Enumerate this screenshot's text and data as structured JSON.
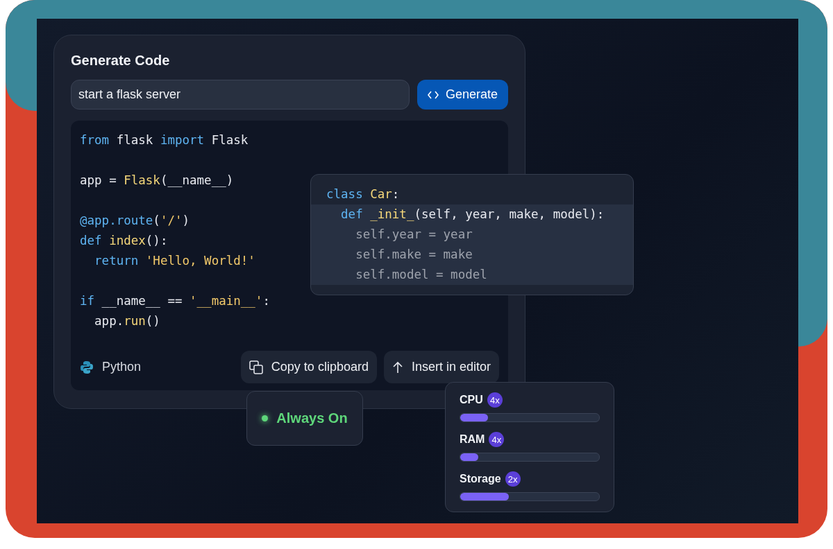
{
  "generator": {
    "title": "Generate Code",
    "prompt": {
      "value": "start a flask server"
    },
    "generate_button": {
      "label": "Generate"
    },
    "code_lines": [
      {
        "kind": "code",
        "tokens": [
          {
            "text": "from",
            "kind": "keyword"
          },
          {
            "text": " flask ",
            "kind": "plain"
          },
          {
            "text": "import",
            "kind": "keyword"
          },
          {
            "text": " Flask",
            "kind": "plain"
          }
        ]
      },
      {
        "kind": "blank"
      },
      {
        "kind": "code",
        "tokens": [
          {
            "text": "app = ",
            "kind": "plain"
          },
          {
            "text": "Flask",
            "kind": "name"
          },
          {
            "text": "(__name__)",
            "kind": "plain"
          }
        ]
      },
      {
        "kind": "blank"
      },
      {
        "kind": "code",
        "tokens": [
          {
            "text": "@app.route",
            "kind": "keyword"
          },
          {
            "text": "(",
            "kind": "plain"
          },
          {
            "text": "'/'",
            "kind": "string"
          },
          {
            "text": ")",
            "kind": "plain"
          }
        ]
      },
      {
        "kind": "code",
        "tokens": [
          {
            "text": "def",
            "kind": "keyword"
          },
          {
            "text": " index",
            "kind": "name"
          },
          {
            "text": "():",
            "kind": "plain"
          }
        ]
      },
      {
        "kind": "code",
        "tokens": [
          {
            "text": "  return ",
            "kind": "keyword"
          },
          {
            "text": "'Hello, World!'",
            "kind": "string"
          }
        ]
      },
      {
        "kind": "blank"
      },
      {
        "kind": "code",
        "tokens": [
          {
            "text": "if",
            "kind": "keyword"
          },
          {
            "text": " __name__ == ",
            "kind": "plain"
          },
          {
            "text": "'__main__'",
            "kind": "string"
          },
          {
            "text": ":",
            "kind": "plain"
          }
        ]
      },
      {
        "kind": "code",
        "tokens": [
          {
            "text": "  app.",
            "kind": "plain"
          },
          {
            "text": "run",
            "kind": "name"
          },
          {
            "text": "()",
            "kind": "plain"
          }
        ]
      }
    ],
    "language": "Python",
    "actions": [
      {
        "kind": "copy",
        "label": "Copy to clipboard"
      },
      {
        "kind": "insert",
        "label": "Insert in editor"
      }
    ]
  },
  "snippet": {
    "code_lines": [
      {
        "highlighted": false,
        "tokens": [
          {
            "text": "class",
            "kind": "keyword"
          },
          {
            "text": " Car",
            "kind": "name"
          },
          {
            "text": ":",
            "kind": "plain"
          }
        ]
      },
      {
        "highlighted": true,
        "tokens": [
          {
            "text": "  def",
            "kind": "keyword"
          },
          {
            "text": " _init_",
            "kind": "name"
          },
          {
            "text": "(self, year, make, model):",
            "kind": "plain"
          }
        ]
      },
      {
        "highlighted": true,
        "tokens": [
          {
            "text": "    self.year = year",
            "kind": "dim"
          }
        ]
      },
      {
        "highlighted": true,
        "tokens": [
          {
            "text": "    self.make = make",
            "kind": "dim"
          }
        ]
      },
      {
        "highlighted": true,
        "tokens": [
          {
            "text": "    self.model = model",
            "kind": "dim"
          }
        ]
      }
    ]
  },
  "status": {
    "label": "Always On",
    "color": "#5ed67a"
  },
  "resources": [
    {
      "name": "CPU",
      "badge": "4x",
      "level": 0.2
    },
    {
      "name": "RAM",
      "badge": "4x",
      "level": 0.13
    },
    {
      "name": "Storage",
      "badge": "2x",
      "level": 0.35
    }
  ]
}
